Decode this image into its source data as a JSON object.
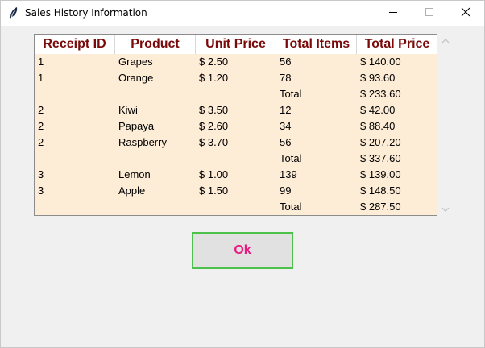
{
  "window": {
    "title": "Sales History Information"
  },
  "table": {
    "columns": [
      "Receipt ID",
      "Product",
      "Unit Price",
      "Total Items",
      "Total Price"
    ],
    "rows": [
      [
        "1",
        "Grapes",
        "$ 2.50",
        "56",
        "$ 140.00"
      ],
      [
        "1",
        "Orange",
        "$ 1.20",
        "78",
        "$ 93.60"
      ],
      [
        "",
        "",
        "",
        "Total",
        "$ 233.60"
      ],
      [
        "2",
        "Kiwi",
        "$ 3.50",
        "12",
        "$ 42.00"
      ],
      [
        "2",
        "Papaya",
        "$ 2.60",
        "34",
        "$ 88.40"
      ],
      [
        "2",
        "Raspberry",
        "$ 3.70",
        "56",
        "$ 207.20"
      ],
      [
        "",
        "",
        "",
        "Total",
        "$ 337.60"
      ],
      [
        "3",
        "Lemon",
        "$ 1.00",
        "139",
        "$ 139.00"
      ],
      [
        "3",
        "Apple",
        "$ 1.50",
        "99",
        "$ 148.50"
      ],
      [
        "",
        "",
        "",
        "Total",
        "$ 287.50"
      ]
    ]
  },
  "ok_button": {
    "label": "Ok"
  },
  "colors": {
    "header_text": "#7a0a0a",
    "row_background": "#fdecd6",
    "ok_text": "#e8187e",
    "ok_border": "#4cc24c"
  },
  "icons": {
    "app": "feather-icon",
    "minimize": "minimize-icon",
    "maximize": "maximize-icon",
    "close": "close-icon",
    "scroll_up": "chevron-up-icon",
    "scroll_down": "chevron-down-icon"
  }
}
